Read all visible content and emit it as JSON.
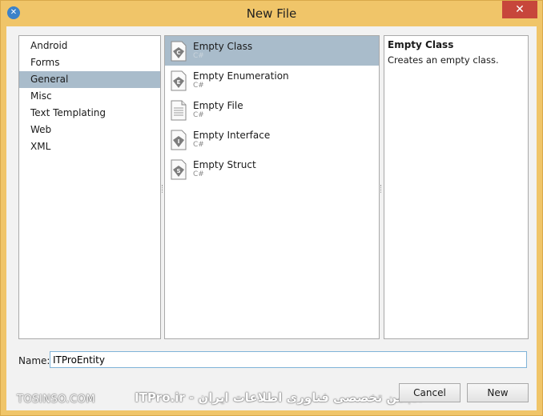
{
  "window": {
    "title": "New File"
  },
  "categories": [
    {
      "label": "Android",
      "selected": false
    },
    {
      "label": "Forms",
      "selected": false
    },
    {
      "label": "General",
      "selected": true
    },
    {
      "label": "Misc",
      "selected": false
    },
    {
      "label": "Text Templating",
      "selected": false
    },
    {
      "label": "Web",
      "selected": false
    },
    {
      "label": "XML",
      "selected": false
    }
  ],
  "templates": [
    {
      "name": "Empty Class",
      "lang": "C#",
      "icon": "class-icon",
      "glyph": "C",
      "selected": true
    },
    {
      "name": "Empty Enumeration",
      "lang": "C#",
      "icon": "enum-icon",
      "glyph": "E",
      "selected": false
    },
    {
      "name": "Empty File",
      "lang": "C#",
      "icon": "file-icon",
      "glyph": "",
      "selected": false
    },
    {
      "name": "Empty Interface",
      "lang": "C#",
      "icon": "interface-icon",
      "glyph": "I",
      "selected": false
    },
    {
      "name": "Empty Struct",
      "lang": "C#",
      "icon": "struct-icon",
      "glyph": "S",
      "selected": false
    }
  ],
  "description": {
    "title": "Empty Class",
    "text": "Creates an empty class."
  },
  "name_field": {
    "label": "Name:",
    "value": "ITProEntity"
  },
  "buttons": {
    "cancel": "Cancel",
    "new": "New"
  },
  "watermarks": {
    "left": "TOSINSO.COM",
    "right": "ITPro.ir - انجمن تخصصی فناوری اطلاعات ایران"
  },
  "colors": {
    "title_bar": "#f0c569",
    "selection": "#a9bccb",
    "close": "#c7463b"
  }
}
